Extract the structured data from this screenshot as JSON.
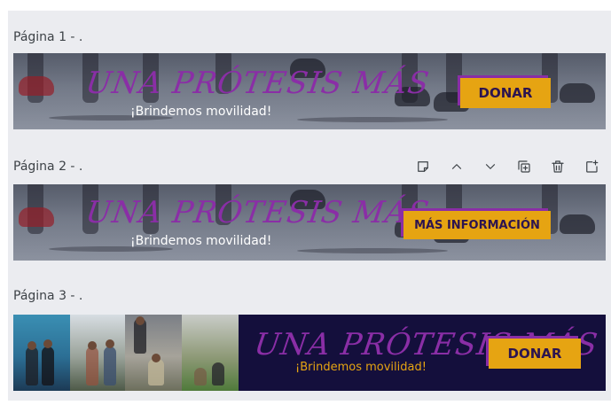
{
  "pages": [
    {
      "label": "Página 1 - .",
      "banner": {
        "title": "UNA PRÓTESIS MÁS",
        "subtitle": "¡Brindemos movilidad!",
        "cta": "DONAR"
      }
    },
    {
      "label": "Página 2 - .",
      "banner": {
        "title": "UNA PRÓTESIS MÁS",
        "subtitle": "¡Brindemos movilidad!",
        "cta": "MÁS INFORMACIÓN"
      }
    },
    {
      "label": "Página 3 - .",
      "banner": {
        "title": "UNA PRÓTESIS MÁS",
        "subtitle": "¡Brindemos movilidad!",
        "cta": "DONAR"
      }
    }
  ],
  "toolbar": {
    "icons": [
      "add-note-icon",
      "move-up-icon",
      "move-down-icon",
      "duplicate-page-icon",
      "delete-page-icon",
      "add-page-icon"
    ]
  },
  "colors": {
    "canvas_bg": "#ebecf0",
    "title_purple": "#8a2ea6",
    "cta_gold": "#e6a412",
    "banner3_bg": "#140f3c"
  }
}
